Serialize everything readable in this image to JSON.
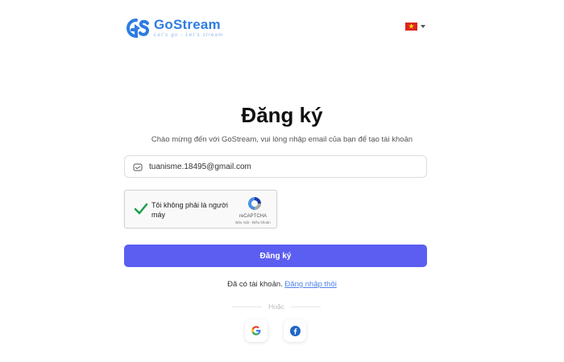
{
  "brand": {
    "name": "GoStream",
    "tagline": "Let's go - Let's stream",
    "color": "#2f7de1"
  },
  "language": {
    "flag_icon": "vietnam-flag-icon"
  },
  "form": {
    "title": "Đăng ký",
    "subtitle": "Chào mừng đến với GoStream, vui lòng nhập email của bạn để tạo tài khoản",
    "email_value": "tuanisme.18495@gmail.com",
    "email_icon": "mail-icon"
  },
  "captcha": {
    "label": "Tôi không phải là người máy",
    "brand": "reCAPTCHA",
    "links": "Bảo mật - Điều khoản",
    "checked": true
  },
  "submit": {
    "label": "Đăng ký",
    "color": "#5b5ef0"
  },
  "login": {
    "prompt": "Đã có tài khoản.",
    "link": "Đăng nhập thôi"
  },
  "divider": {
    "text": "Hoặc"
  },
  "social": {
    "google_icon": "google-icon",
    "facebook_icon": "facebook-icon"
  }
}
